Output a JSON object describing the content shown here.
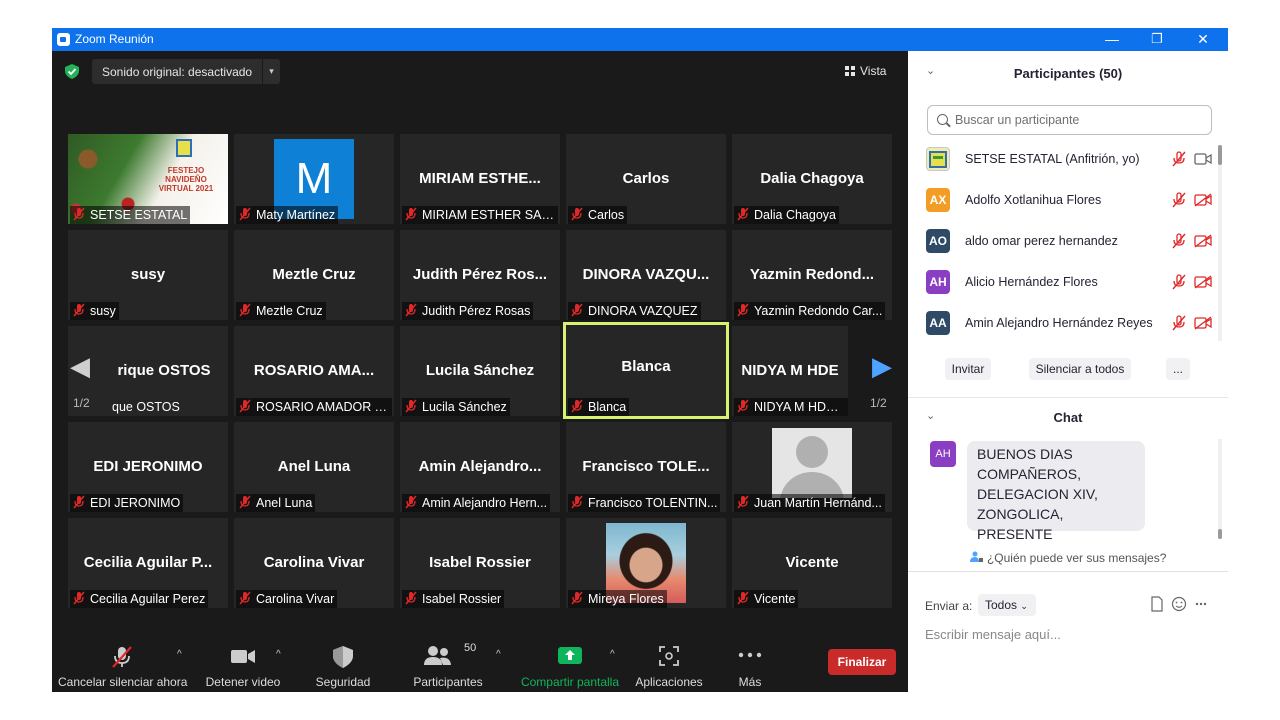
{
  "window": {
    "title": "Zoom Reunión",
    "minimize": "—",
    "restore": "❐",
    "close": "✕"
  },
  "video": {
    "sound_label": "Sonido original: desactivado",
    "sound_caret": "▾",
    "view_label": "Vista",
    "page_left": "1/2",
    "page_right": "1/2",
    "nav_prev": "◀",
    "nav_next": "▶",
    "festejo_text": "FESTEJO NAVIDEÑO VIRTUAL 2021",
    "m_letter": "M",
    "tiles": [
      {
        "big": "",
        "name": "SETSE ESTATAL"
      },
      {
        "big": "",
        "name": "Maty Martínez"
      },
      {
        "big": "MIRIAM ESTHE...",
        "name": "MIRIAM ESTHER SAN..."
      },
      {
        "big": "Carlos",
        "name": "Carlos"
      },
      {
        "big": "Dalia Chagoya",
        "name": "Dalia Chagoya"
      },
      {
        "big": "susy",
        "name": "susy"
      },
      {
        "big": "Meztle Cruz",
        "name": "Meztle Cruz"
      },
      {
        "big": "Judith Pérez Ros...",
        "name": "Judith Pérez Rosas"
      },
      {
        "big": "DINORA VAZQU...",
        "name": "DINORA VAZQUEZ"
      },
      {
        "big": "Yazmin Redond...",
        "name": "Yazmin Redondo Car..."
      },
      {
        "big": "rique OSTOS",
        "name": "que OSTOS"
      },
      {
        "big": "ROSARIO AMA...",
        "name": "ROSARIO AMADOR T..."
      },
      {
        "big": "Lucila Sánchez",
        "name": "Lucila Sánchez"
      },
      {
        "big": "Blanca",
        "name": "Blanca"
      },
      {
        "big": "NIDYA M HDE",
        "name": "NIDYA M HDEZ I"
      },
      {
        "big": "EDI JERONIMO",
        "name": "EDI JERONIMO"
      },
      {
        "big": "Anel Luna",
        "name": "Anel Luna"
      },
      {
        "big": "Amin Alejandro...",
        "name": "Amin Alejandro Hern..."
      },
      {
        "big": "Francisco TOLE...",
        "name": "Francisco TOLENTIN..."
      },
      {
        "big": "",
        "name": "Juan Martín Hernánd..."
      },
      {
        "big": "Cecilia Aguilar P...",
        "name": "Cecilia Aguilar Perez"
      },
      {
        "big": "Carolina Vivar",
        "name": "Carolina Vivar"
      },
      {
        "big": "Isabel Rossier",
        "name": "Isabel Rossier"
      },
      {
        "big": "",
        "name": "Mireya Flores"
      },
      {
        "big": "Vicente",
        "name": "Vicente"
      }
    ]
  },
  "toolbar": {
    "unmute": "Cancelar silenciar ahora",
    "video": "Detener video",
    "security": "Seguridad",
    "participants": "Participantes",
    "participants_count": "50",
    "share": "Compartir pantalla",
    "apps": "Aplicaciones",
    "more": "Más",
    "end": "Finalizar",
    "caret": "^"
  },
  "panel": {
    "participants_header": "Participantes (50)",
    "search_placeholder": "Buscar un participante",
    "participants": [
      {
        "initials": "",
        "name": "SETSE ESTATAL (Anfitrión, yo)",
        "color": "#e7e04a"
      },
      {
        "initials": "AX",
        "name": "Adolfo Xotlanihua Flores",
        "color": "#f39c26"
      },
      {
        "initials": "AO",
        "name": "aldo omar perez hernandez",
        "color": "#2f4a66"
      },
      {
        "initials": "AH",
        "name": "Alicio Hernández Flores",
        "color": "#8a3ec2"
      },
      {
        "initials": "AA",
        "name": "Amin Alejandro Hernández Reyes",
        "color": "#2f4a66"
      }
    ],
    "invite": "Invitar",
    "mute_all": "Silenciar a todos",
    "more_btn": "...",
    "chat_header": "Chat",
    "chat_msg_initials": "AH",
    "chat_msg_lines": [
      "BUENOS DIAS",
      "COMPAÑEROS,",
      "DELEGACION XIV,",
      "ZONGOLICA, PRESENTE"
    ],
    "who_can_see": "¿Quién puede ver sus mensajes?",
    "send_to_label": "Enviar a:",
    "send_to_value": "Todos",
    "compose_placeholder": "Escribir mensaje aquí...",
    "chev": "⌄"
  },
  "colors": {
    "accent": "#0e72ed",
    "active_speaker": "#d6f26e",
    "mute_red": "#e02828",
    "end_red": "#c92b2b",
    "share_green": "#0fb55a"
  }
}
